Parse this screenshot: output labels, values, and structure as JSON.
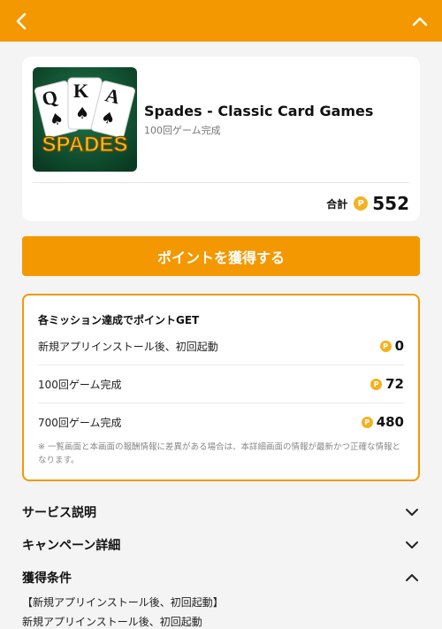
{
  "header": {
    "back_icon": "chevron-left-icon",
    "collapse_icon": "chevron-up-icon",
    "bg": "#f39800"
  },
  "app": {
    "name": "Spades - Classic Card Games",
    "subtitle": "100回ゲーム完成",
    "icon_text": "SPADES",
    "icon_cards": [
      "Q",
      "K",
      "A"
    ]
  },
  "total": {
    "label": "合計",
    "coin_symbol": "P",
    "value": "552"
  },
  "cta": {
    "label": "ポイントを獲得する"
  },
  "missions": {
    "title": "各ミッション達成でポイントGET",
    "items": [
      {
        "label": "新規アプリインストール後、初回起動",
        "points": "0"
      },
      {
        "label": "100回ゲーム完成",
        "points": "72"
      },
      {
        "label": "700回ゲーム完成",
        "points": "480"
      }
    ],
    "note": "※ 一覧画面と本画面の報酬情報に差異がある場合は、本詳細画面の情報が最新かつ正確な情報となります。"
  },
  "sections": {
    "service": {
      "title": "サービス説明",
      "state": "collapsed"
    },
    "campaign": {
      "title": "キャンペーン詳細",
      "state": "collapsed"
    },
    "conditions": {
      "title": "獲得条件",
      "state": "expanded"
    }
  },
  "conditions": {
    "line1": "【新規アプリインストール後、初回起動】",
    "line2": "新規アプリインストール後、初回起動"
  },
  "colors": {
    "accent": "#f39800",
    "coin": "#f3b21f",
    "background": "#f4f4f4"
  }
}
